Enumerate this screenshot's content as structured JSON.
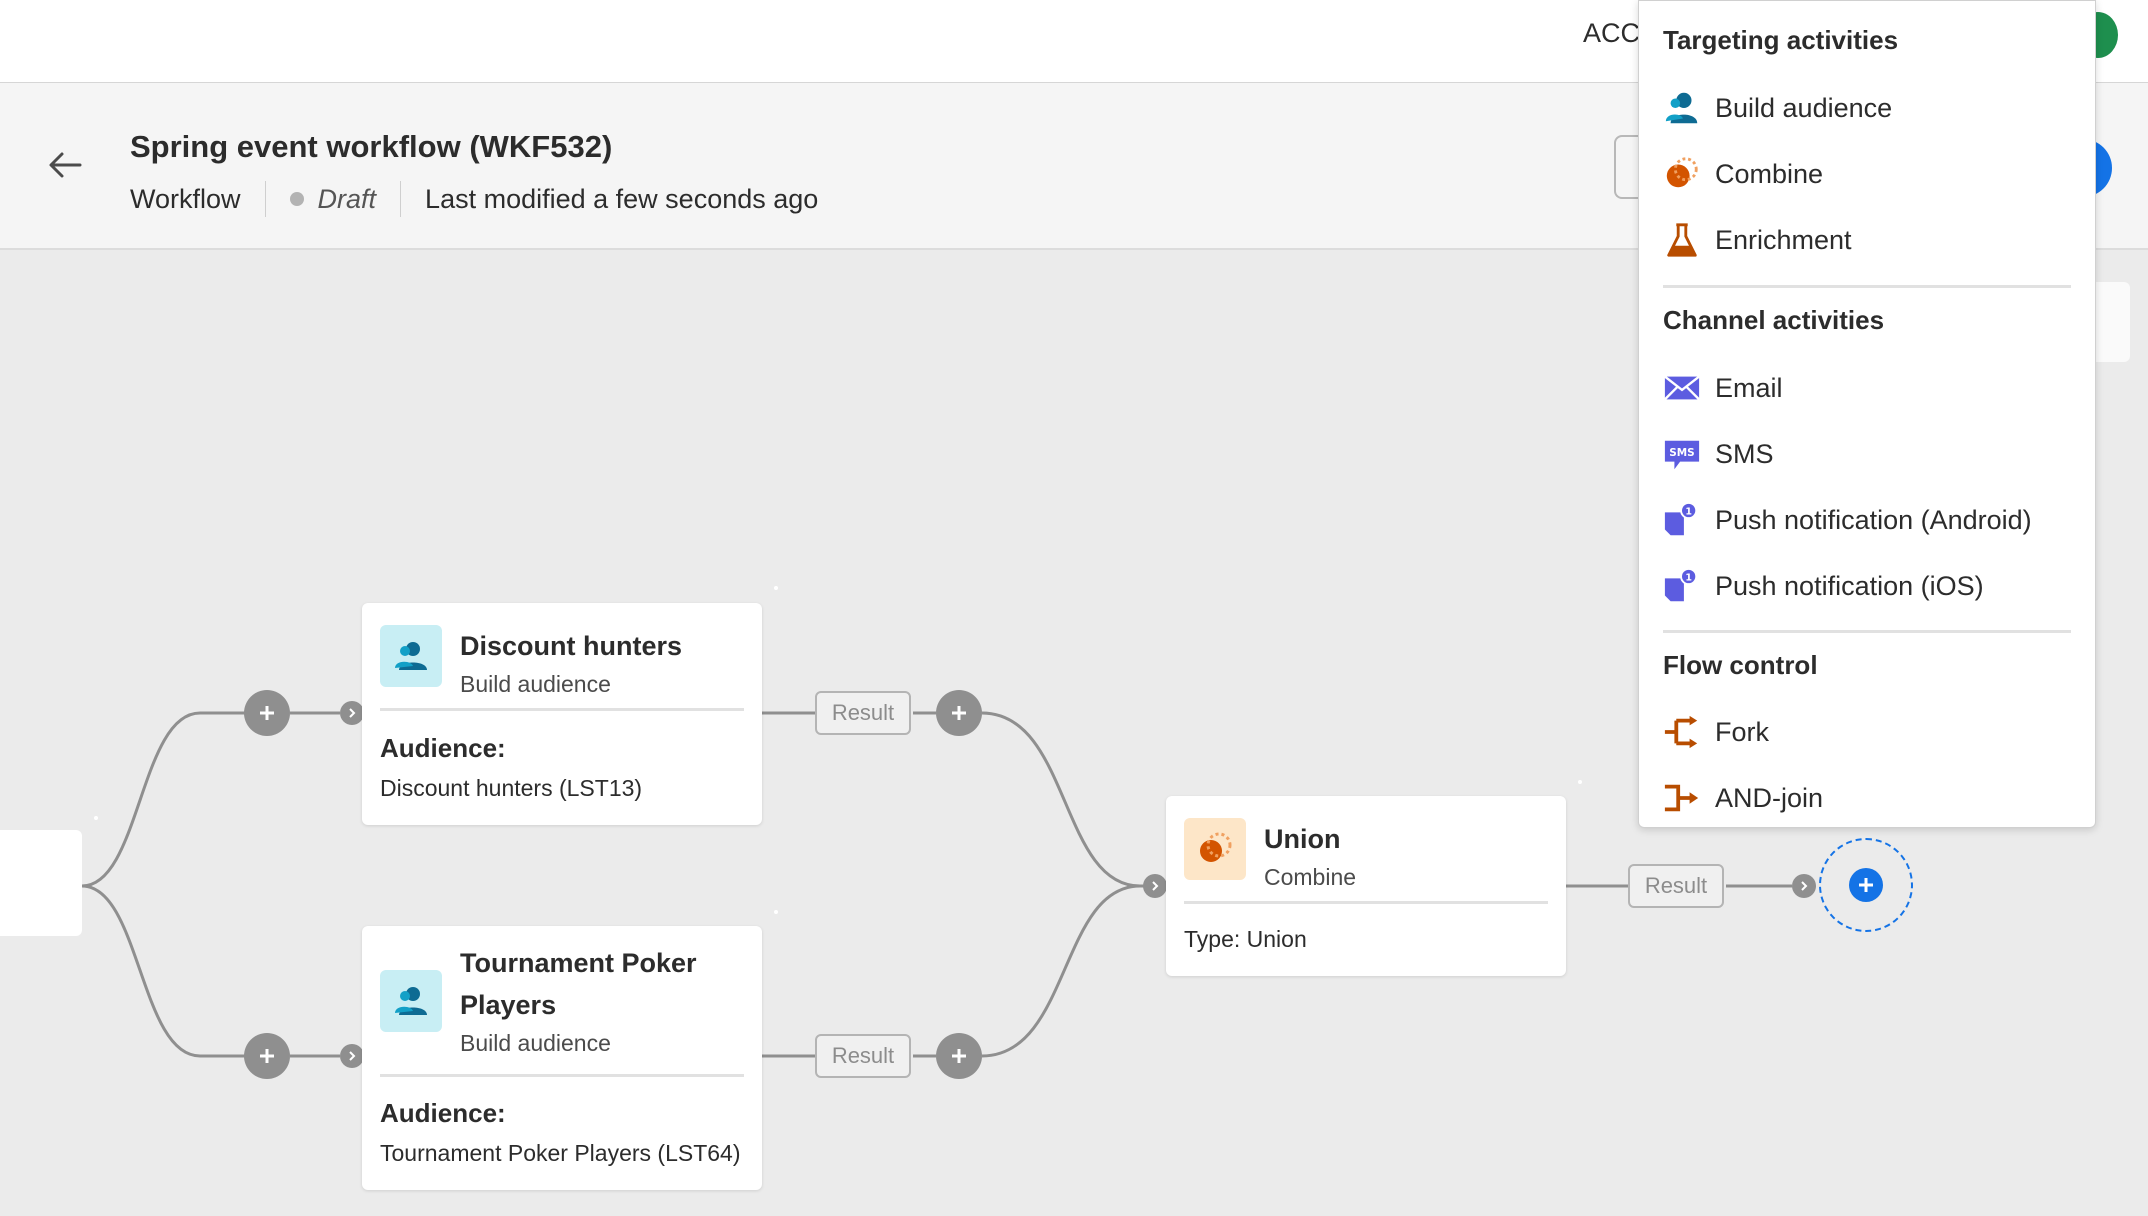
{
  "topbar": {
    "org_label": "ACC"
  },
  "header": {
    "title": "Spring event workflow (WKF532)",
    "type_label": "Workflow",
    "status": "Draft",
    "last_modified": "Last modified a few seconds ago"
  },
  "nodes": {
    "discount": {
      "title": "Discount hunters",
      "subtitle": "Build audience",
      "field_label": "Audience:",
      "field_value": "Discount hunters (LST13)"
    },
    "poker": {
      "title_line1": "Tournament Poker",
      "title_line2": "Players",
      "subtitle": "Build audience",
      "field_label": "Audience:",
      "field_value": "Tournament Poker Players (LST64)"
    },
    "union": {
      "title": "Union",
      "subtitle": "Combine",
      "field_value": "Type: Union"
    }
  },
  "transitions": {
    "result_label": "Result"
  },
  "menu": {
    "targeting": {
      "heading": "Targeting activities",
      "items": [
        {
          "label": "Build audience",
          "icon": "build-audience-icon"
        },
        {
          "label": "Combine",
          "icon": "combine-icon"
        },
        {
          "label": "Enrichment",
          "icon": "enrichment-icon"
        }
      ]
    },
    "channel": {
      "heading": "Channel activities",
      "items": [
        {
          "label": "Email",
          "icon": "email-icon"
        },
        {
          "label": "SMS",
          "icon": "sms-icon"
        },
        {
          "label": "Push notification (Android)",
          "icon": "push-notification-icon"
        },
        {
          "label": "Push notification (iOS)",
          "icon": "push-notification-icon"
        }
      ]
    },
    "flow": {
      "heading": "Flow control",
      "items": [
        {
          "label": "Fork",
          "icon": "fork-icon"
        },
        {
          "label": "AND-join",
          "icon": "and-join-icon"
        }
      ]
    }
  },
  "colors": {
    "accent": "#1473e6",
    "audience_icon": "#0d66d0",
    "combine_icon": "#d35400",
    "channel_icon": "#5c5ce0",
    "flow_icon": "#b84d00"
  }
}
